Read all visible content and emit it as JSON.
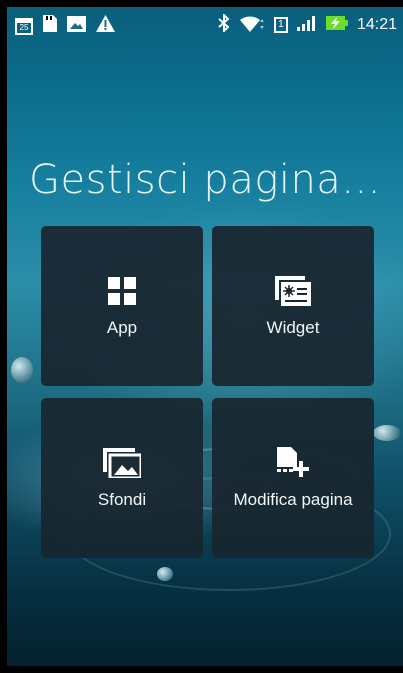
{
  "status_bar": {
    "time": "14:21",
    "calendar_day": "25",
    "sim_slot": "1",
    "icons": [
      "calendar-icon",
      "sd-card-icon",
      "image-icon",
      "warning-icon",
      "bluetooth-icon",
      "wifi-icon",
      "sim-icon",
      "signal-icon",
      "battery-charging-icon"
    ]
  },
  "title": "Gestisci pagina...",
  "tiles": [
    {
      "label": "App",
      "icon": "apps-grid-icon"
    },
    {
      "label": "Widget",
      "icon": "widget-icon"
    },
    {
      "label": "Sfondi",
      "icon": "wallpaper-icon"
    },
    {
      "label": "Modifica pagina",
      "icon": "edit-page-icon"
    }
  ],
  "colors": {
    "tile_background": "#18262f",
    "text": "#f2f6f8",
    "battery_green": "#6edc2d"
  }
}
